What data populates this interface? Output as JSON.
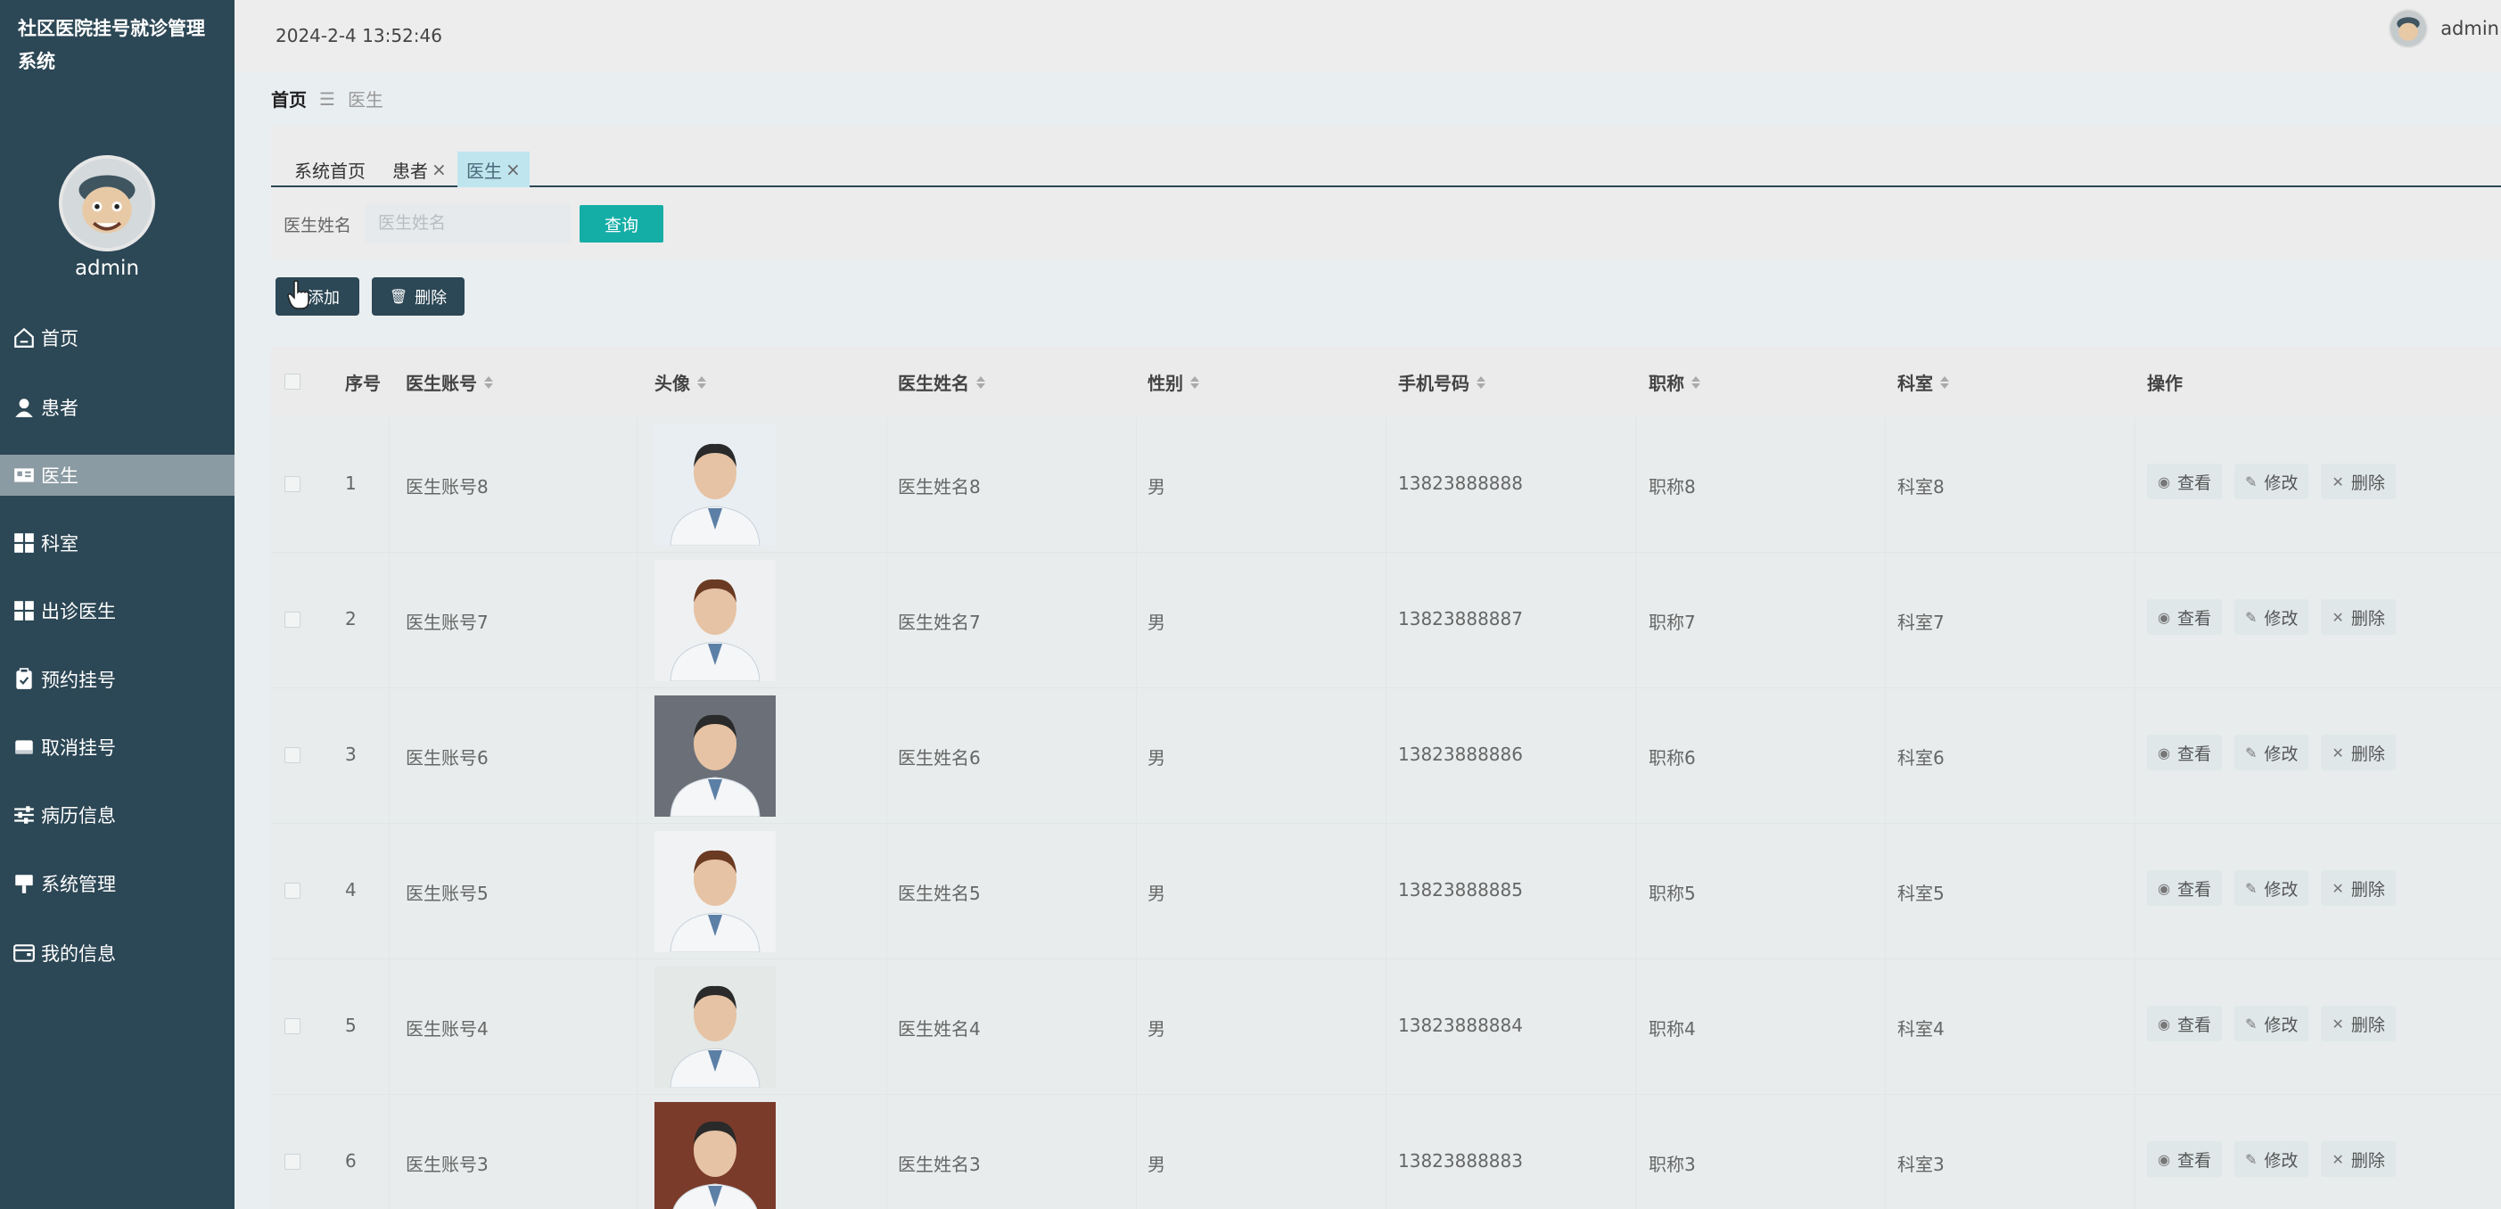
{
  "sidebar": {
    "title": "社区医院挂号就诊管理系统",
    "username": "admin",
    "items": [
      {
        "label": "首页",
        "icon": "home-icon"
      },
      {
        "label": "患者",
        "icon": "user-icon"
      },
      {
        "label": "医生",
        "icon": "doctor-icon"
      },
      {
        "label": "科室",
        "icon": "grid-icon"
      },
      {
        "label": "出诊医生",
        "icon": "grid-icon"
      },
      {
        "label": "预约挂号",
        "icon": "clipboard-icon"
      },
      {
        "label": "取消挂号",
        "icon": "card-icon"
      },
      {
        "label": "病历信息",
        "icon": "sliders-icon"
      },
      {
        "label": "系统管理",
        "icon": "stamp-icon"
      },
      {
        "label": "我的信息",
        "icon": "wallet-icon"
      }
    ]
  },
  "header": {
    "datetime": "2024-2-4 13:52:46",
    "username": "admin"
  },
  "breadcrumb": {
    "home": "首页",
    "separator": "☰",
    "current": "医生"
  },
  "tabs": [
    {
      "label": "系统首页",
      "closable": false
    },
    {
      "label": "患者",
      "closable": true
    },
    {
      "label": "医生",
      "closable": true
    }
  ],
  "search": {
    "label": "医生姓名",
    "placeholder": "医生姓名",
    "button": "查询"
  },
  "toolbar": {
    "add_label": "添加",
    "delete_label": "删除"
  },
  "table": {
    "headers": {
      "index": "序号",
      "account": "医生账号",
      "avatar": "头像",
      "name": "医生姓名",
      "gender": "性别",
      "phone": "手机号码",
      "title": "职称",
      "dept": "科室",
      "ops": "操作"
    },
    "actions": {
      "view": "查看",
      "edit": "修改",
      "delete": "删除"
    },
    "rows": [
      {
        "index": "1",
        "account": "医生账号8",
        "name": "医生姓名8",
        "gender": "男",
        "phone": "13823888888",
        "title": "职称8",
        "dept": "科室8"
      },
      {
        "index": "2",
        "account": "医生账号7",
        "name": "医生姓名7",
        "gender": "男",
        "phone": "13823888887",
        "title": "职称7",
        "dept": "科室7"
      },
      {
        "index": "3",
        "account": "医生账号6",
        "name": "医生姓名6",
        "gender": "男",
        "phone": "13823888886",
        "title": "职称6",
        "dept": "科室6"
      },
      {
        "index": "4",
        "account": "医生账号5",
        "name": "医生姓名5",
        "gender": "男",
        "phone": "13823888885",
        "title": "职称5",
        "dept": "科室5"
      },
      {
        "index": "5",
        "account": "医生账号4",
        "name": "医生姓名4",
        "gender": "男",
        "phone": "13823888884",
        "title": "职称4",
        "dept": "科室4"
      },
      {
        "index": "6",
        "account": "医生账号3",
        "name": "医生姓名3",
        "gender": "男",
        "phone": "13823888883",
        "title": "职称3",
        "dept": "科室3"
      }
    ]
  },
  "colors": {
    "sidebar_bg": "#2c4755",
    "active_item": "#8b9ba3",
    "query_button": "#15aea7",
    "active_tab": "#bfe5ef"
  }
}
